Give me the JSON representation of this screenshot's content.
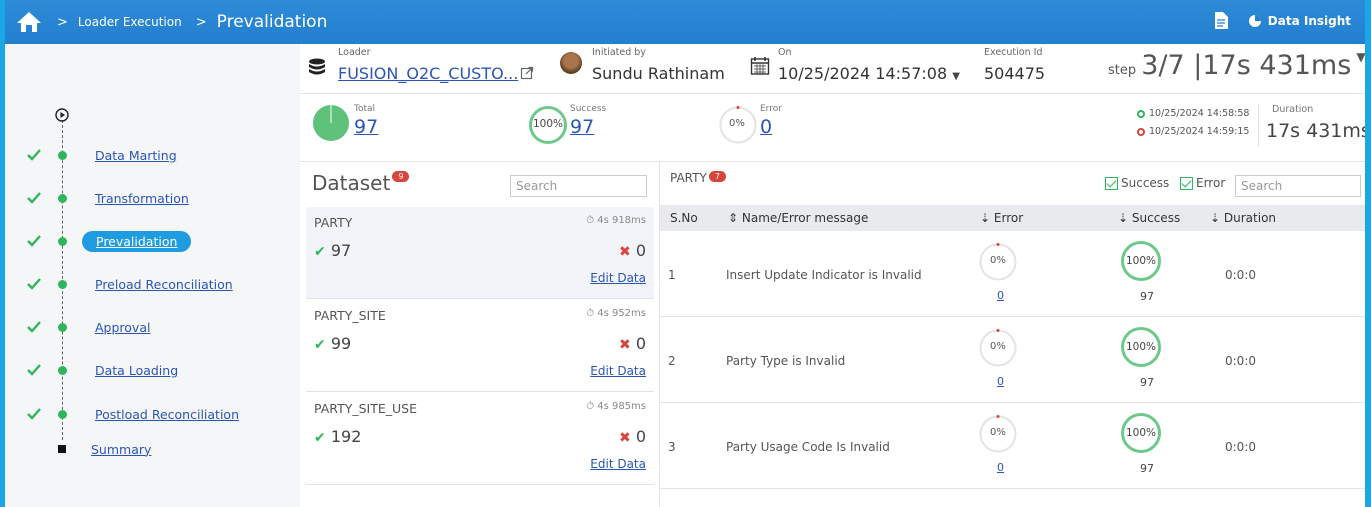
{
  "breadcrumb": {
    "level1": "Loader Execution",
    "level2": "Prevalidation"
  },
  "top_actions": {
    "insight_label": "Data Insight"
  },
  "steps": [
    {
      "label": "Data Marting",
      "done": true
    },
    {
      "label": "Transformation",
      "done": true
    },
    {
      "label": "Prevalidation",
      "done": true,
      "active": true
    },
    {
      "label": "Preload Reconciliation",
      "done": true
    },
    {
      "label": "Approval",
      "done": true
    },
    {
      "label": "Data Loading",
      "done": true
    },
    {
      "label": "Postload Reconciliation",
      "done": true
    },
    {
      "label": "Summary",
      "done": false
    }
  ],
  "header": {
    "loader_label": "Loader",
    "loader_value": "FUSION_O2C_CUSTO...",
    "initiated_label": "Initiated by",
    "initiated_value": "Sundu Rathinam",
    "on_label": "On",
    "on_value": "10/25/2024 14:57:08",
    "exec_label": "Execution Id",
    "exec_value": "504475",
    "step_word": "step",
    "step_value": "3/7 |17s 431ms"
  },
  "stats": {
    "total_label": "Total",
    "total_value": "97",
    "success_label": "Success",
    "success_value": "97",
    "success_pct": "100%",
    "error_label": "Error",
    "error_value": "0",
    "error_pct": "0%",
    "start_time": "10/25/2024 14:58:58",
    "end_time": "10/25/2024 14:59:15",
    "duration_label": "Duration",
    "duration_value": "17s 431ms"
  },
  "dataset": {
    "title": "Dataset",
    "badge": "9",
    "search_placeholder": "Search",
    "items": [
      {
        "name": "PARTY",
        "time": "4s 918ms",
        "success": "97",
        "error": "0",
        "edit": "Edit Data"
      },
      {
        "name": "PARTY_SITE",
        "time": "4s 952ms",
        "success": "99",
        "error": "0",
        "edit": "Edit Data"
      },
      {
        "name": "PARTY_SITE_USE",
        "time": "4s 985ms",
        "success": "192",
        "error": "0",
        "edit": "Edit Data"
      }
    ]
  },
  "party": {
    "title": "PARTY",
    "badge": "7",
    "filter_success": "Success",
    "filter_error": "Error",
    "search_placeholder": "Search",
    "columns": {
      "sno": "S.No",
      "name": "Name/Error message",
      "error": "Error",
      "success": "Success",
      "duration": "Duration"
    },
    "rows": [
      {
        "sno": "1",
        "name": "Insert Update Indicator is Invalid",
        "error_pct": "0%",
        "error": "0",
        "success_pct": "100%",
        "success": "97",
        "duration": "0:0:0"
      },
      {
        "sno": "2",
        "name": "Party Type is Invalid",
        "error_pct": "0%",
        "error": "0",
        "success_pct": "100%",
        "success": "97",
        "duration": "0:0:0"
      },
      {
        "sno": "3",
        "name": "Party Usage Code Is Invalid",
        "error_pct": "0%",
        "error": "0",
        "success_pct": "100%",
        "success": "97",
        "duration": "0:0:0"
      }
    ]
  },
  "colors": {
    "accent": "#247fcf",
    "success": "#2fb55a",
    "error": "#d9443b",
    "link": "#2b55b5"
  }
}
